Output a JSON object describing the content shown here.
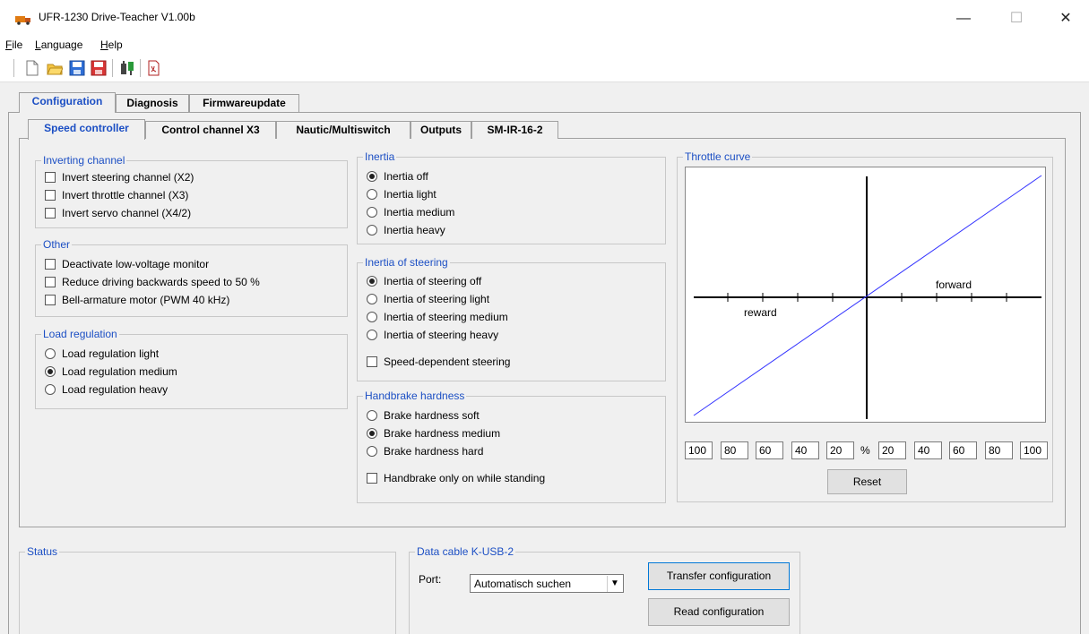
{
  "window": {
    "title": "UFR-1230 Drive-Teacher V1.00b",
    "minimize": "—",
    "maximize": "☐",
    "close": "✕"
  },
  "menu": [
    {
      "first": "F",
      "rest": "ile"
    },
    {
      "first": "L",
      "rest": "anguage"
    },
    {
      "first": "H",
      "rest": "elp"
    }
  ],
  "toolbar_icons": [
    "new-file-icon",
    "open-folder-icon",
    "save-icon",
    "save-as-icon",
    "connect-device-icon",
    "pdf-icon"
  ],
  "main_tabs": [
    "Configuration",
    "Diagnosis",
    "Firmwareupdate"
  ],
  "sub_tabs": [
    "Speed controller",
    "Control channel X3",
    "Nautic/Multiswitch",
    "Outputs",
    "SM-IR-16-2"
  ],
  "inverting": {
    "title": "Inverting channel",
    "options": [
      "Invert steering channel (X2)",
      "Invert throttle channel (X3)",
      "Invert servo channel (X4/2)"
    ]
  },
  "other": {
    "title": "Other",
    "options": [
      "Deactivate low-voltage monitor",
      "Reduce driving backwards speed to 50 %",
      "Bell-armature motor (PWM 40 kHz)"
    ]
  },
  "load_regulation": {
    "title": "Load regulation",
    "options": [
      "Load regulation light",
      "Load regulation medium",
      "Load regulation heavy"
    ],
    "selected": 1
  },
  "inertia": {
    "title": "Inertia",
    "options": [
      "Inertia off",
      "Inertia light",
      "Inertia medium",
      "Inertia heavy"
    ],
    "selected": 0
  },
  "inertia_steering": {
    "title": "Inertia of steering",
    "options": [
      "Inertia of steering off",
      "Inertia of steering light",
      "Inertia of steering medium",
      "Inertia of steering heavy"
    ],
    "selected": 0,
    "checkbox": "Speed-dependent steering"
  },
  "handbrake": {
    "title": "Handbrake hardness",
    "options": [
      "Brake hardness soft",
      "Brake hardness medium",
      "Brake hardness hard"
    ],
    "selected": 1,
    "checkbox": "Handbrake only on while standing"
  },
  "throttle": {
    "title": "Throttle curve",
    "forward_label": "forward",
    "reward_label": "reward",
    "left_values": [
      "100",
      "80",
      "60",
      "40",
      "20"
    ],
    "percent": "%",
    "right_values": [
      "20",
      "40",
      "60",
      "80",
      "100"
    ],
    "reset": "Reset"
  },
  "status": {
    "title": "Status"
  },
  "cable": {
    "title": "Data cable K-USB-2",
    "port_label": "Port:",
    "port_value": "Automatisch suchen",
    "transfer": "Transfer configuration",
    "read": "Read configuration"
  },
  "colors": {
    "accent": "#1c4fc4",
    "curve": "#3333ff"
  }
}
